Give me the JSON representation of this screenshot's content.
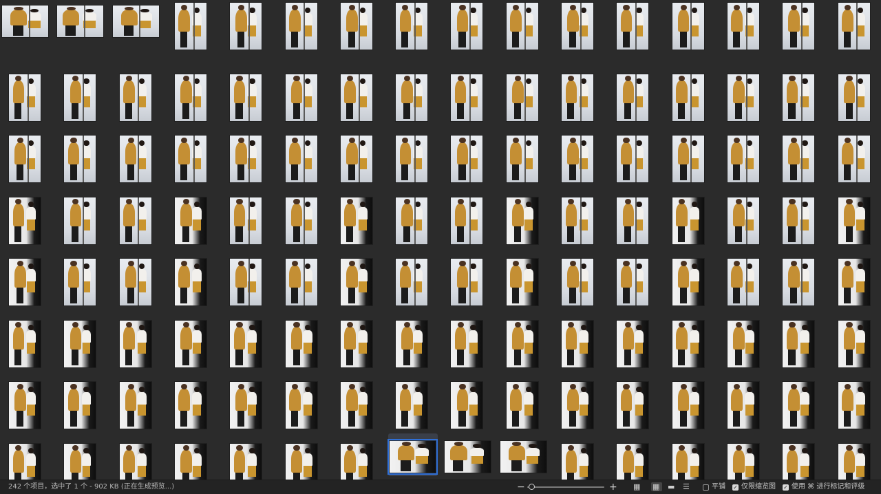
{
  "window": {
    "background": "#2b2b2b",
    "selection_color": "#2f6fd6"
  },
  "grid": {
    "columns": 16,
    "rows_visible": 8,
    "landscape_cells": [
      [
        0,
        0
      ],
      [
        0,
        1
      ],
      [
        0,
        2
      ],
      [
        7,
        7
      ],
      [
        7,
        8
      ],
      [
        7,
        9
      ]
    ],
    "selected_cell": [
      7,
      7
    ]
  },
  "status_bar": {
    "summary": "242 个项目，选中了 1 个 - 902 KB (正在生成预览...)",
    "zoom_out_icon": "minus-icon",
    "zoom_in_icon": "plus-icon",
    "zoom_level_percent": 5,
    "views": [
      {
        "name": "grid-view",
        "icon": "grid-icon",
        "active": false
      },
      {
        "name": "thumbnail-view",
        "icon": "thumbnail-grid-icon",
        "active": true
      },
      {
        "name": "filmstrip-view",
        "icon": "filmstrip-icon",
        "active": false
      },
      {
        "name": "list-view",
        "icon": "list-icon",
        "active": false
      }
    ],
    "options": [
      {
        "label": "平铺",
        "checked": false
      },
      {
        "label": "仅限缩览图",
        "checked": true
      },
      {
        "label": "使用 ⌘ 进行标记和评级",
        "checked": true
      }
    ]
  }
}
